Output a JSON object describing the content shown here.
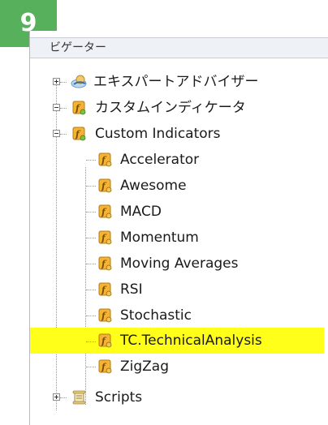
{
  "badge": {
    "number": "9"
  },
  "navigator": {
    "header_title": "ビゲーター",
    "tree": [
      {
        "label": "エキスパートアドバイザー",
        "icon": "expert-advisor-icon",
        "expander": "plus"
      },
      {
        "label": "カスタムインディケータ",
        "icon": "indicator-folder-icon",
        "expander": "minus"
      },
      {
        "label": "Custom Indicators",
        "icon": "indicator-folder-icon",
        "expander": "minus",
        "children": [
          {
            "label": "Accelerator",
            "icon": "indicator-icon"
          },
          {
            "label": "Awesome",
            "icon": "indicator-icon"
          },
          {
            "label": "MACD",
            "icon": "indicator-icon"
          },
          {
            "label": "Momentum",
            "icon": "indicator-icon"
          },
          {
            "label": "Moving Averages",
            "icon": "indicator-icon"
          },
          {
            "label": "RSI",
            "icon": "indicator-icon"
          },
          {
            "label": "Stochastic",
            "icon": "indicator-icon"
          },
          {
            "label": "TC.TechnicalAnalysis",
            "icon": "indicator-icon",
            "highlighted": true,
            "highlight_color": "#ffff1a"
          },
          {
            "label": "ZigZag",
            "icon": "indicator-icon"
          }
        ]
      },
      {
        "label": "Scripts",
        "icon": "scripts-icon",
        "expander": "plus"
      }
    ]
  },
  "colors": {
    "badge": "#57b05b",
    "highlight": "#ffff1a",
    "indicator_icon": "#f5b335"
  }
}
